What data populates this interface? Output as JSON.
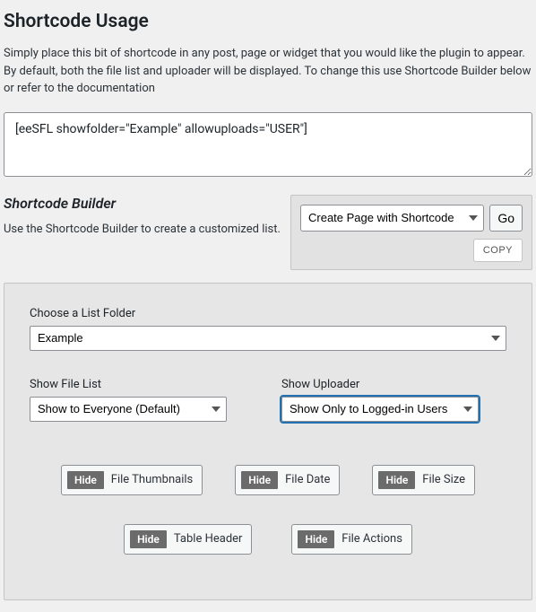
{
  "heading": "Shortcode Usage",
  "intro": "Simply place this bit of shortcode in any post, page or widget that you would like the plugin to appear. By default, both the file list and uploader will be displayed. To change this use Shortcode Builder below or refer to the documentation",
  "shortcode": "[eeSFL showfolder=\"Example\" allowuploads=\"USER\"]",
  "builder": {
    "title": "Shortcode Builder",
    "desc": "Use the Shortcode Builder to create a customized list.",
    "create_option": "Create Page with Shortcode",
    "go": "Go",
    "copy": "COPY"
  },
  "options": {
    "folder_label": "Choose a List Folder",
    "folder_value": "Example",
    "filelist_label": "Show File List",
    "filelist_value": "Show to Everyone (Default)",
    "uploader_label": "Show Uploader",
    "uploader_value": "Show Only to Logged-in Users",
    "hide": "Hide",
    "toggles": {
      "thumbnails": "File Thumbnails",
      "date": "File Date",
      "size": "File Size",
      "header": "Table Header",
      "actions": "File Actions"
    }
  }
}
